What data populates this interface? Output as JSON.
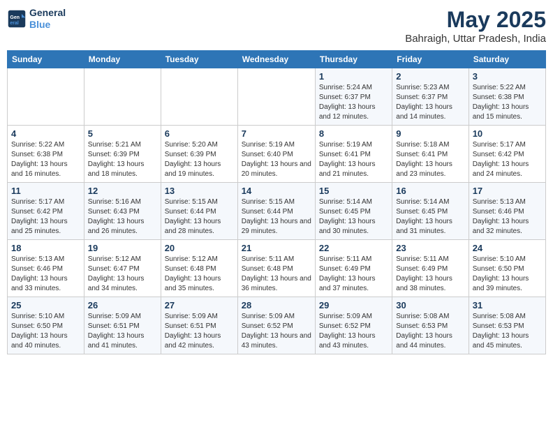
{
  "header": {
    "logo_line1": "General",
    "logo_line2": "Blue",
    "month": "May 2025",
    "location": "Bahraigh, Uttar Pradesh, India"
  },
  "days_of_week": [
    "Sunday",
    "Monday",
    "Tuesday",
    "Wednesday",
    "Thursday",
    "Friday",
    "Saturday"
  ],
  "weeks": [
    [
      {
        "day": "",
        "content": ""
      },
      {
        "day": "",
        "content": ""
      },
      {
        "day": "",
        "content": ""
      },
      {
        "day": "",
        "content": ""
      },
      {
        "day": "1",
        "content": "Sunrise: 5:24 AM\nSunset: 6:37 PM\nDaylight: 13 hours\nand 12 minutes."
      },
      {
        "day": "2",
        "content": "Sunrise: 5:23 AM\nSunset: 6:37 PM\nDaylight: 13 hours\nand 14 minutes."
      },
      {
        "day": "3",
        "content": "Sunrise: 5:22 AM\nSunset: 6:38 PM\nDaylight: 13 hours\nand 15 minutes."
      }
    ],
    [
      {
        "day": "4",
        "content": "Sunrise: 5:22 AM\nSunset: 6:38 PM\nDaylight: 13 hours\nand 16 minutes."
      },
      {
        "day": "5",
        "content": "Sunrise: 5:21 AM\nSunset: 6:39 PM\nDaylight: 13 hours\nand 18 minutes."
      },
      {
        "day": "6",
        "content": "Sunrise: 5:20 AM\nSunset: 6:39 PM\nDaylight: 13 hours\nand 19 minutes."
      },
      {
        "day": "7",
        "content": "Sunrise: 5:19 AM\nSunset: 6:40 PM\nDaylight: 13 hours\nand 20 minutes."
      },
      {
        "day": "8",
        "content": "Sunrise: 5:19 AM\nSunset: 6:41 PM\nDaylight: 13 hours\nand 21 minutes."
      },
      {
        "day": "9",
        "content": "Sunrise: 5:18 AM\nSunset: 6:41 PM\nDaylight: 13 hours\nand 23 minutes."
      },
      {
        "day": "10",
        "content": "Sunrise: 5:17 AM\nSunset: 6:42 PM\nDaylight: 13 hours\nand 24 minutes."
      }
    ],
    [
      {
        "day": "11",
        "content": "Sunrise: 5:17 AM\nSunset: 6:42 PM\nDaylight: 13 hours\nand 25 minutes."
      },
      {
        "day": "12",
        "content": "Sunrise: 5:16 AM\nSunset: 6:43 PM\nDaylight: 13 hours\nand 26 minutes."
      },
      {
        "day": "13",
        "content": "Sunrise: 5:15 AM\nSunset: 6:44 PM\nDaylight: 13 hours\nand 28 minutes."
      },
      {
        "day": "14",
        "content": "Sunrise: 5:15 AM\nSunset: 6:44 PM\nDaylight: 13 hours\nand 29 minutes."
      },
      {
        "day": "15",
        "content": "Sunrise: 5:14 AM\nSunset: 6:45 PM\nDaylight: 13 hours\nand 30 minutes."
      },
      {
        "day": "16",
        "content": "Sunrise: 5:14 AM\nSunset: 6:45 PM\nDaylight: 13 hours\nand 31 minutes."
      },
      {
        "day": "17",
        "content": "Sunrise: 5:13 AM\nSunset: 6:46 PM\nDaylight: 13 hours\nand 32 minutes."
      }
    ],
    [
      {
        "day": "18",
        "content": "Sunrise: 5:13 AM\nSunset: 6:46 PM\nDaylight: 13 hours\nand 33 minutes."
      },
      {
        "day": "19",
        "content": "Sunrise: 5:12 AM\nSunset: 6:47 PM\nDaylight: 13 hours\nand 34 minutes."
      },
      {
        "day": "20",
        "content": "Sunrise: 5:12 AM\nSunset: 6:48 PM\nDaylight: 13 hours\nand 35 minutes."
      },
      {
        "day": "21",
        "content": "Sunrise: 5:11 AM\nSunset: 6:48 PM\nDaylight: 13 hours\nand 36 minutes."
      },
      {
        "day": "22",
        "content": "Sunrise: 5:11 AM\nSunset: 6:49 PM\nDaylight: 13 hours\nand 37 minutes."
      },
      {
        "day": "23",
        "content": "Sunrise: 5:11 AM\nSunset: 6:49 PM\nDaylight: 13 hours\nand 38 minutes."
      },
      {
        "day": "24",
        "content": "Sunrise: 5:10 AM\nSunset: 6:50 PM\nDaylight: 13 hours\nand 39 minutes."
      }
    ],
    [
      {
        "day": "25",
        "content": "Sunrise: 5:10 AM\nSunset: 6:50 PM\nDaylight: 13 hours\nand 40 minutes."
      },
      {
        "day": "26",
        "content": "Sunrise: 5:09 AM\nSunset: 6:51 PM\nDaylight: 13 hours\nand 41 minutes."
      },
      {
        "day": "27",
        "content": "Sunrise: 5:09 AM\nSunset: 6:51 PM\nDaylight: 13 hours\nand 42 minutes."
      },
      {
        "day": "28",
        "content": "Sunrise: 5:09 AM\nSunset: 6:52 PM\nDaylight: 13 hours\nand 43 minutes."
      },
      {
        "day": "29",
        "content": "Sunrise: 5:09 AM\nSunset: 6:52 PM\nDaylight: 13 hours\nand 43 minutes."
      },
      {
        "day": "30",
        "content": "Sunrise: 5:08 AM\nSunset: 6:53 PM\nDaylight: 13 hours\nand 44 minutes."
      },
      {
        "day": "31",
        "content": "Sunrise: 5:08 AM\nSunset: 6:53 PM\nDaylight: 13 hours\nand 45 minutes."
      }
    ]
  ]
}
